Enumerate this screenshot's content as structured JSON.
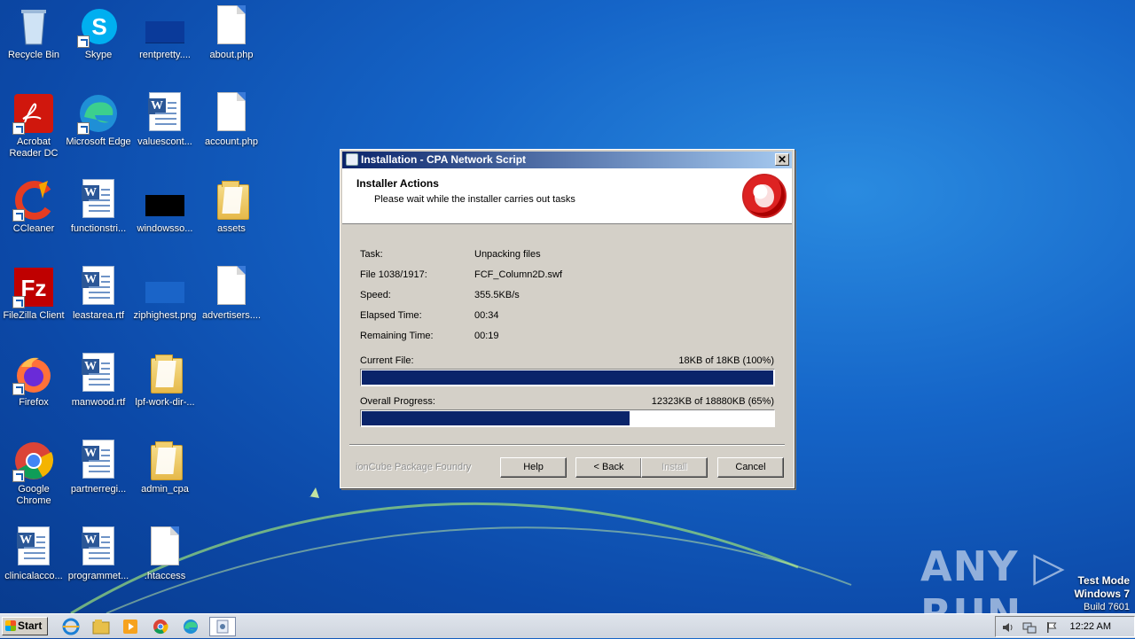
{
  "desktop": {
    "icons": [
      {
        "label": "Recycle Bin"
      },
      {
        "label": "Skype"
      },
      {
        "label": "rentpretty...."
      },
      {
        "label": "about.php"
      },
      {
        "label": "Acrobat Reader DC"
      },
      {
        "label": "Microsoft Edge"
      },
      {
        "label": "valuescont..."
      },
      {
        "label": "account.php"
      },
      {
        "label": "CCleaner"
      },
      {
        "label": "functionstri..."
      },
      {
        "label": "windowsso..."
      },
      {
        "label": "assets"
      },
      {
        "label": "FileZilla Client"
      },
      {
        "label": "leastarea.rtf"
      },
      {
        "label": "ziphighest.png"
      },
      {
        "label": "advertisers...."
      },
      {
        "label": "Firefox"
      },
      {
        "label": "manwood.rtf"
      },
      {
        "label": "lpf-work-dir-..."
      },
      {
        "label": "Google Chrome"
      },
      {
        "label": "partnerregi..."
      },
      {
        "label": "admin_cpa"
      },
      {
        "label": "clinicalacco..."
      },
      {
        "label": "programmet..."
      },
      {
        "label": ".htaccess"
      }
    ]
  },
  "installer": {
    "title": "Installation - CPA Network Script",
    "header_title": "Installer Actions",
    "header_subtitle": "Please wait while the installer carries out tasks",
    "fields": [
      {
        "label": "Task:",
        "value": "Unpacking files"
      },
      {
        "label": "File 1038/1917:",
        "value": "FCF_Column2D.swf"
      },
      {
        "label": "Speed:",
        "value": "355.5KB/s"
      },
      {
        "label": "Elapsed Time:",
        "value": "00:34"
      },
      {
        "label": "Remaining Time:",
        "value": "00:19"
      }
    ],
    "current_file": {
      "label": "Current File:",
      "status": "18KB of 18KB (100%)",
      "progress": 1.0
    },
    "overall": {
      "label": "Overall Progress:",
      "status": "12323KB of 18880KB (65%)",
      "progress": 0.65
    },
    "brand": "ionCube Package Foundry",
    "buttons": {
      "help": "Help",
      "back": "< Back",
      "install": "Install",
      "cancel": "Cancel"
    },
    "close_glyph": "✕"
  },
  "watermark": {
    "anyrun": "ANY ▷ RUN",
    "line1": "Test Mode",
    "line2": "Windows 7",
    "line3": "Build 7601"
  },
  "taskbar": {
    "start_label": "Start",
    "clock": "12:22 AM"
  }
}
